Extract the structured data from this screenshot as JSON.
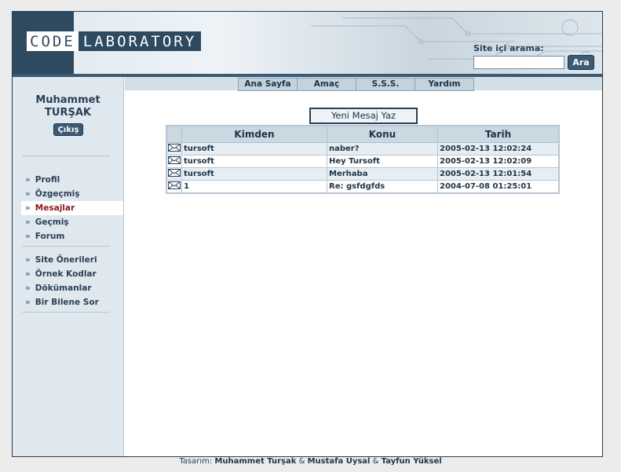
{
  "header": {
    "logo_left": "CODE",
    "logo_right": "LABORATORY",
    "search_label": "Site içi arama:",
    "search_value": "",
    "search_button": "Ara"
  },
  "sidebar": {
    "user_first": "Muhammet",
    "user_last": "TURŞAK",
    "logout_label": "Çıkış",
    "arrow": "»",
    "nav_main": [
      "Profil",
      "Özgeçmiş",
      "Mesajlar",
      "Geçmiş",
      "Forum"
    ],
    "nav_secondary": [
      "Site Önerileri",
      "Örnek Kodlar",
      "Dökümanlar",
      "Bir Bilene Sor"
    ]
  },
  "topnav": [
    "Ana Sayfa",
    "Amaç",
    "S.S.S.",
    "Yardım"
  ],
  "messages": {
    "new_message_label": "Yeni Mesaj Yaz",
    "columns": [
      "Kimden",
      "Konu",
      "Tarih"
    ],
    "rows": [
      {
        "from": "tursoft",
        "subject": "naber?",
        "date": "2005-02-13 12:02:24"
      },
      {
        "from": "tursoft",
        "subject": "Hey Tursoft",
        "date": "2005-02-13 12:02:09"
      },
      {
        "from": "tursoft",
        "subject": "Merhaba",
        "date": "2005-02-13 12:01:54"
      },
      {
        "from": "1",
        "subject": "Re: gsfdgfds",
        "date": "2004-07-08 01:25:01"
      }
    ]
  },
  "footer": {
    "prefix": "Tasarım:",
    "author1": "Muhammet Turşak",
    "amp": "&",
    "author2": "Mustafa Uysal",
    "author3": "Tayfun Yüksel"
  },
  "colors": {
    "accent": "#3c5a73",
    "sidebar_bg": "#dfe8ee",
    "active_link": "#8b1a1a"
  }
}
